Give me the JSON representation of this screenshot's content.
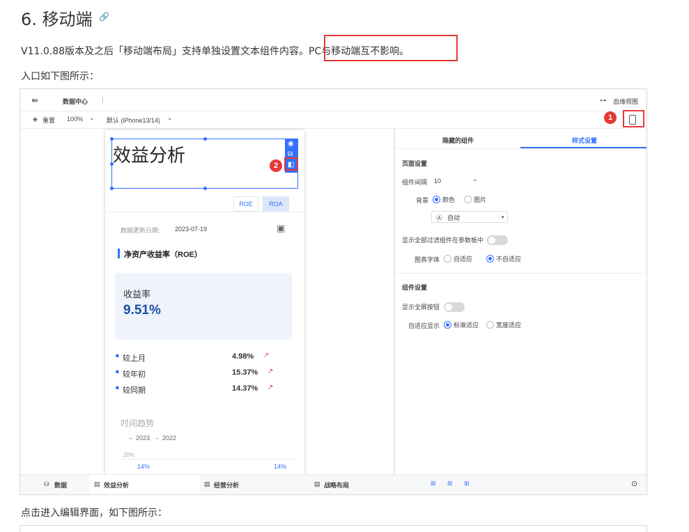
{
  "heading": {
    "title": "6. 移动端",
    "link_icon": "link-icon"
  },
  "intro": {
    "text_a": "V11.0.88版本及之后「移动端布局」支持单独设置文本组件内容",
    "text_b": "。PC与移动端互不影响。"
  },
  "entry_text": "入口如下图所示：",
  "after_text": "点击进入编辑界面，如下图所示：",
  "app": {
    "back_icon": "⇚",
    "title": "数据中心",
    "more": "⋮",
    "lineage": "血缘视图",
    "reset": "重置",
    "zoom": "100%",
    "device": "默认 (iPhone13/14)"
  },
  "phone": {
    "component_title": "效益分析",
    "tab_roe": "ROE",
    "tab_roa": "ROA",
    "date_label": "数据更新日期:",
    "date_value": "2023-07-19",
    "section_title": "净资产收益率（ROE）",
    "card_label": "收益率",
    "card_value": "9.51%",
    "metrics": [
      {
        "label": "较上月",
        "value": "4.98%"
      },
      {
        "label": "较年初",
        "value": "15.37%"
      },
      {
        "label": "较同期",
        "value": "14.37%"
      }
    ],
    "trend_title": "时间趋势",
    "legend_2023": "2023",
    "legend_2022": "2022",
    "axis_20": "20%",
    "point_left": "14%",
    "point_right": "14%"
  },
  "panel": {
    "tab_hidden": "隐藏的组件",
    "tab_style": "样式设置",
    "page_settings": "页面设置",
    "gap_label": "组件间隔",
    "gap_value": "10",
    "bg_label": "背景",
    "bg_color": "颜色",
    "bg_image": "图片",
    "auto_label": "自动",
    "show_filter": "显示全部过滤组件在参数板中",
    "chart_font": "图表字体",
    "font_auto": "自适应",
    "font_noauto": "不自适应",
    "component_settings": "组件设置",
    "show_fullscreen": "显示全屏按钮",
    "adaptive_display": "自适应显示",
    "adaptive_standard": "标准适应",
    "adaptive_width": "宽度适应"
  },
  "bottom": {
    "data": "数据",
    "tab1": "效益分析",
    "tab2": "经营分析",
    "tab3": "战略布局"
  },
  "markers": {
    "one": "1",
    "two": "2"
  },
  "colors": {
    "accent": "#3370ff",
    "highlight": "#e53935",
    "up": "#e8453c"
  }
}
